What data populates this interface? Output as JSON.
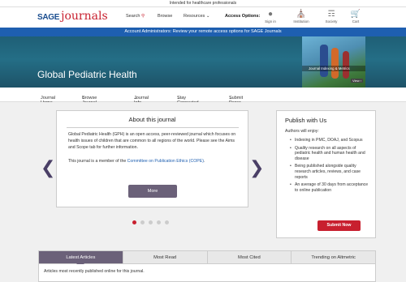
{
  "topbar": {
    "text": "Intended for healthcare professionals"
  },
  "header": {
    "logo_sage": "SAGE",
    "logo_journals": "journals",
    "search_label": "Search",
    "browse_label": "Browse",
    "resources_label": "Resources",
    "access_options": "Access Options",
    "icons": [
      {
        "label": "Sign in",
        "icon": "user-icon"
      },
      {
        "label": "Institution",
        "icon": "institution-icon"
      },
      {
        "label": "Society",
        "icon": "society-icon"
      },
      {
        "label": "Cart",
        "icon": "cart-icon"
      }
    ]
  },
  "banner": {
    "text": "Account Administrators: Review your remote access options for SAGE Journals"
  },
  "hero": {
    "title": "Global Pediatric Health",
    "cover_caption": "Journal Indexing & Metrics",
    "cover_view": "View"
  },
  "journal_nav": [
    "Journal Home",
    "Browse Journal",
    "Journal Info",
    "Stay Connected",
    "Submit Paper"
  ],
  "about": {
    "heading": "About this journal",
    "p1": "Global Pediatric Health (GPH) is an open access, peer-reviewed journal which focuses on health issues of children that are common to all regions of the world. Please see the Aims and Scope tab for further information.",
    "p2_prefix": "This journal is a member of the ",
    "p2_link": "Committee on Publication Ethics (COPE)",
    "p2_suffix": ".",
    "more_label": "More"
  },
  "carousel": {
    "active_index": 0,
    "count": 5
  },
  "publish": {
    "heading": "Publish with Us",
    "intro": "Authors will enjoy:",
    "items": [
      "Indexing in PMC, DOAJ, and Scopus",
      "Quality research on all aspects of pediatric health and human health and disease",
      "Being published alongside quality research articles, reviews, and case reports",
      "An average of 30 days from acceptance to online publication"
    ],
    "submit_label": "Submit Now"
  },
  "tabs": {
    "items": [
      "Latest Articles",
      "Most Read",
      "Most Cited",
      "Trending on Altmetric"
    ],
    "active": 0,
    "body_text": "Articles most recently published online for this journal."
  },
  "colors": {
    "brand_red": "#c8202f",
    "brand_blue": "#1e5fb0",
    "accent_purple": "#6b6179"
  }
}
